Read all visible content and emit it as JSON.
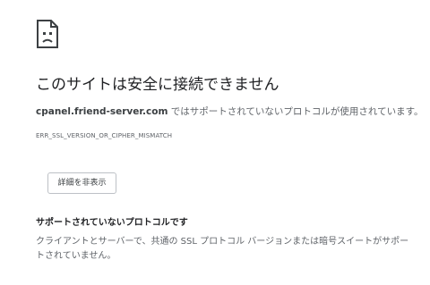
{
  "error": {
    "title": "このサイトは安全に接続できません",
    "host": "cpanel.friend-server.com",
    "summary_suffix": " ではサポートされていないプロトコルが使用されています。",
    "code": "ERR_SSL_VERSION_OR_CIPHER_MISMATCH"
  },
  "details": {
    "toggle_label": "詳細を非表示",
    "heading": "サポートされていないプロトコルです",
    "body": "クライアントとサーバーで、共通の SSL プロトコル バージョンまたは暗号スイートがサポートされていません。"
  },
  "icons": {
    "error_icon": "sad-page-icon"
  },
  "colors": {
    "text_primary": "#202124",
    "text_secondary": "#5f6368",
    "button_border": "#bdc1c6"
  }
}
